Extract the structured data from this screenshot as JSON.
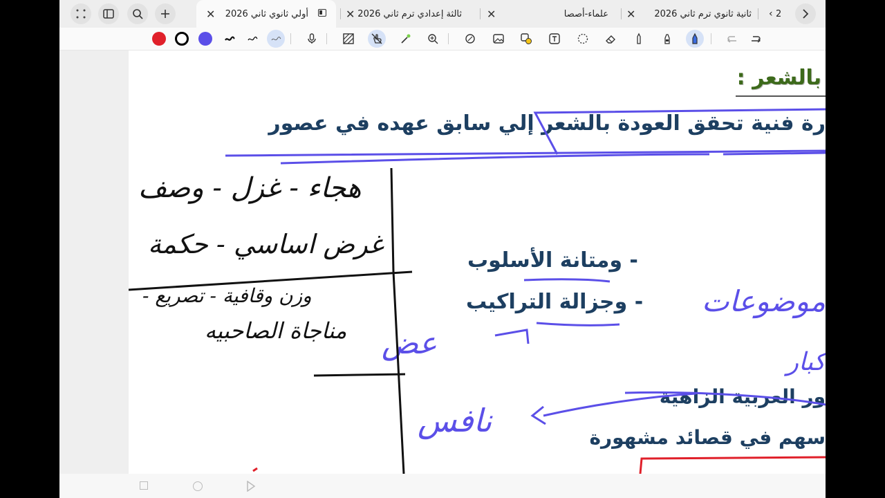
{
  "tabs": {
    "counter": "2",
    "items": [
      {
        "label": "ثانية ثانوي ترم ثاني 2026"
      },
      {
        "label": "علماء-أصصا"
      },
      {
        "label": "ثالثة إعدادي ترم ثاني 2026"
      },
      {
        "label": "أولي ثانوي  ثاني 2026"
      }
    ]
  },
  "toolbar": {
    "colors": {
      "red": "#e0202a",
      "black": "#000000",
      "blue": "#5b4fe8"
    },
    "tools": [
      "pen-icon",
      "highlighter-icon",
      "lasso-pen-icon",
      "mic-icon",
      "texture-icon",
      "touch-disabled-icon",
      "laser-icon",
      "zoom-icon",
      "shape-icon",
      "image-icon",
      "sticker-icon",
      "text-icon",
      "lasso-icon",
      "eraser-icon",
      "pencil-icon",
      "marker-icon",
      "highlighter-pen-icon",
      "undo-icon",
      "redo-icon"
    ]
  },
  "content": {
    "section_heading": "بالشعر :",
    "headline": "رة فنية تحقق العودة بالشعر إلي سابق عهده في عصور",
    "bullet_1": "- ومتانة الأسلوب",
    "bullet_2": "- وجزالة التراكيب",
    "line_3": "ور العربية  الزاهية",
    "line_4": "سهم في قصائد مشهورة",
    "hw_1": "هجاء - غزل - وصف",
    "hw_2": "غرض اساسي - حكمة",
    "hw_3": "وزن وقافية - تصريع -",
    "hw_4": "مناجاة الصاحبيه",
    "hw_5": "موضوعات",
    "hw_6": "عض",
    "hw_7": "كبار",
    "hw_8": "نافس"
  }
}
